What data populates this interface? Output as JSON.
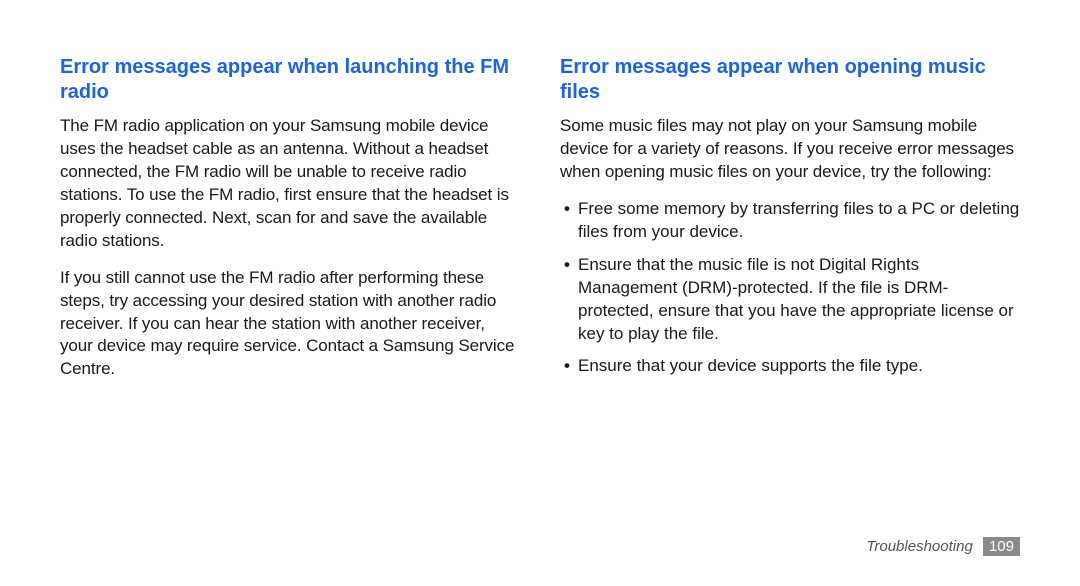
{
  "left": {
    "heading": "Error messages appear when launching the FM radio",
    "p1": "The FM radio application on your Samsung mobile device uses the headset cable as an antenna. Without a headset connected, the FM radio will be unable to receive radio stations. To use the FM radio, first ensure that the headset is properly connected. Next, scan for and save the available radio stations.",
    "p2": "If you still cannot use the FM radio after performing these steps, try accessing your desired station with another radio receiver. If you can hear the station with another receiver, your device may require service. Contact a Samsung Service Centre."
  },
  "right": {
    "heading": "Error messages appear when opening music files",
    "intro": "Some music files may not play on your Samsung mobile device for a variety of reasons. If you receive error messages when opening music files on your device, try the following:",
    "bullets": [
      "Free some memory by transferring files to a PC or deleting files from your device.",
      "Ensure that the music file is not Digital Rights Management (DRM)-protected. If the file is DRM-protected, ensure that you have the appropriate license or key to play the file.",
      "Ensure that your device supports the file type."
    ]
  },
  "footer": {
    "section": "Troubleshooting",
    "page": "109"
  }
}
